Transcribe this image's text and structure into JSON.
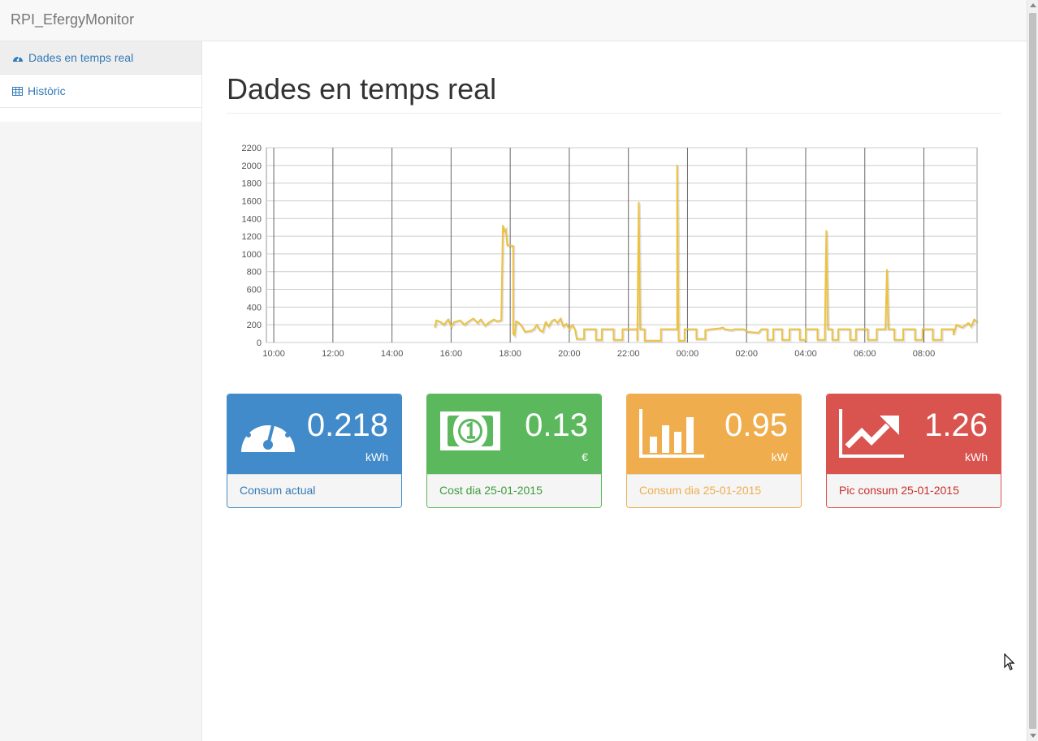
{
  "app": {
    "brand": "RPI_EfergyMonitor"
  },
  "sidebar": {
    "items": [
      {
        "label": "Dades en temps real",
        "icon": "dashboard-icon",
        "active": true
      },
      {
        "label": "Històric",
        "icon": "table-icon",
        "active": false
      }
    ]
  },
  "main": {
    "title": "Dades en temps real"
  },
  "chart_data": {
    "type": "line",
    "title": "",
    "xlabel": "",
    "ylabel": "",
    "ylim": [
      0,
      2200
    ],
    "yticks": [
      "0",
      "200",
      "400",
      "600",
      "800",
      "1000",
      "1200",
      "1400",
      "1600",
      "1800",
      "2000",
      "2200"
    ],
    "xticks": [
      "10:00",
      "12:00",
      "14:00",
      "16:00",
      "18:00",
      "20:00",
      "22:00",
      "00:00",
      "02:00",
      "04:00",
      "06:00",
      "08:00"
    ],
    "x_range_hours": [
      9.75,
      33.8
    ],
    "series": [
      {
        "color": "#edc240",
        "points": [
          [
            15.45,
            170
          ],
          [
            15.5,
            250
          ],
          [
            15.65,
            230
          ],
          [
            15.75,
            200
          ],
          [
            15.9,
            260
          ],
          [
            16.0,
            180
          ],
          [
            16.1,
            230
          ],
          [
            16.3,
            250
          ],
          [
            16.45,
            200
          ],
          [
            16.6,
            240
          ],
          [
            16.75,
            270
          ],
          [
            16.9,
            220
          ],
          [
            17.0,
            260
          ],
          [
            17.15,
            190
          ],
          [
            17.3,
            230
          ],
          [
            17.45,
            260
          ],
          [
            17.55,
            240
          ],
          [
            17.7,
            250
          ],
          [
            17.75,
            1320
          ],
          [
            17.8,
            1250
          ],
          [
            17.85,
            1280
          ],
          [
            17.9,
            1100
          ],
          [
            18.1,
            1090
          ],
          [
            18.1,
            100
          ],
          [
            18.15,
            80
          ],
          [
            18.2,
            240
          ],
          [
            18.3,
            220
          ],
          [
            18.4,
            180
          ],
          [
            18.5,
            120
          ],
          [
            18.7,
            130
          ],
          [
            18.8,
            150
          ],
          [
            18.9,
            200
          ],
          [
            19.0,
            140
          ],
          [
            19.1,
            120
          ],
          [
            19.2,
            230
          ],
          [
            19.3,
            180
          ],
          [
            19.4,
            240
          ],
          [
            19.5,
            260
          ],
          [
            19.6,
            220
          ],
          [
            19.7,
            270
          ],
          [
            19.8,
            180
          ],
          [
            19.9,
            210
          ],
          [
            20.0,
            150
          ],
          [
            20.1,
            200
          ],
          [
            20.2,
            140
          ],
          [
            20.25,
            40
          ],
          [
            20.5,
            40
          ],
          [
            20.5,
            150
          ],
          [
            20.9,
            150
          ],
          [
            20.9,
            30
          ],
          [
            21.1,
            30
          ],
          [
            21.1,
            150
          ],
          [
            21.5,
            150
          ],
          [
            21.5,
            30
          ],
          [
            21.8,
            30
          ],
          [
            21.8,
            150
          ],
          [
            22.3,
            150
          ],
          [
            22.3,
            20
          ],
          [
            22.35,
            1580
          ],
          [
            22.4,
            150
          ],
          [
            22.55,
            150
          ],
          [
            22.55,
            20
          ],
          [
            23.1,
            20
          ],
          [
            23.1,
            150
          ],
          [
            23.65,
            150
          ],
          [
            23.65,
            2000
          ],
          [
            23.7,
            20
          ],
          [
            23.9,
            20
          ],
          [
            23.9,
            150
          ],
          [
            24.3,
            150
          ],
          [
            24.3,
            40
          ],
          [
            24.6,
            40
          ],
          [
            24.6,
            140
          ],
          [
            24.8,
            150
          ],
          [
            25.1,
            160
          ],
          [
            25.2,
            170
          ],
          [
            25.25,
            150
          ],
          [
            25.5,
            140
          ],
          [
            25.6,
            150
          ],
          [
            25.9,
            150
          ],
          [
            26.05,
            120
          ],
          [
            26.4,
            110
          ],
          [
            26.5,
            150
          ],
          [
            26.7,
            150
          ],
          [
            26.7,
            30
          ],
          [
            26.9,
            30
          ],
          [
            26.9,
            150
          ],
          [
            27.2,
            150
          ],
          [
            27.2,
            30
          ],
          [
            27.45,
            30
          ],
          [
            27.45,
            150
          ],
          [
            27.8,
            150
          ],
          [
            27.8,
            30
          ],
          [
            28.0,
            30
          ],
          [
            28.0,
            150
          ],
          [
            28.4,
            150
          ],
          [
            28.4,
            30
          ],
          [
            28.65,
            30
          ],
          [
            28.65,
            150
          ],
          [
            28.7,
            1260
          ],
          [
            28.75,
            150
          ],
          [
            28.9,
            150
          ],
          [
            28.9,
            30
          ],
          [
            29.1,
            30
          ],
          [
            29.1,
            150
          ],
          [
            29.5,
            150
          ],
          [
            29.5,
            30
          ],
          [
            29.7,
            30
          ],
          [
            29.7,
            150
          ],
          [
            30.1,
            150
          ],
          [
            30.1,
            30
          ],
          [
            30.4,
            30
          ],
          [
            30.4,
            150
          ],
          [
            30.7,
            150
          ],
          [
            30.75,
            820
          ],
          [
            30.8,
            150
          ],
          [
            31.0,
            150
          ],
          [
            31.0,
            30
          ],
          [
            31.3,
            30
          ],
          [
            31.3,
            150
          ],
          [
            31.7,
            150
          ],
          [
            31.7,
            30
          ],
          [
            31.95,
            30
          ],
          [
            31.95,
            150
          ],
          [
            32.3,
            150
          ],
          [
            32.3,
            30
          ],
          [
            32.6,
            30
          ],
          [
            32.6,
            150
          ],
          [
            33.0,
            150
          ],
          [
            33.0,
            90
          ],
          [
            33.1,
            200
          ],
          [
            33.3,
            170
          ],
          [
            33.5,
            220
          ],
          [
            33.6,
            180
          ],
          [
            33.7,
            260
          ],
          [
            33.8,
            230
          ]
        ]
      }
    ]
  },
  "panels": [
    {
      "value": "0.218",
      "unit": "kWh",
      "caption": "Consum actual",
      "icon": "dashboard-gauge-icon",
      "color": "#428bca",
      "text_color": "#337ab7"
    },
    {
      "value": "0.13",
      "unit": "€",
      "caption": "Cost dia 25-01-2015",
      "icon": "money-icon",
      "color": "#5cb85c",
      "text_color": "#3c9c3c"
    },
    {
      "value": "0.95",
      "unit": "kW",
      "caption": "Consum dia 25-01-2015",
      "icon": "bar-chart-icon",
      "color": "#f0ad4e",
      "text_color": "#f0ad4e"
    },
    {
      "value": "1.26",
      "unit": "kWh",
      "caption": "Pic consum 25-01-2015",
      "icon": "line-chart-icon",
      "color": "#d9534f",
      "text_color": "#c9302c"
    }
  ]
}
